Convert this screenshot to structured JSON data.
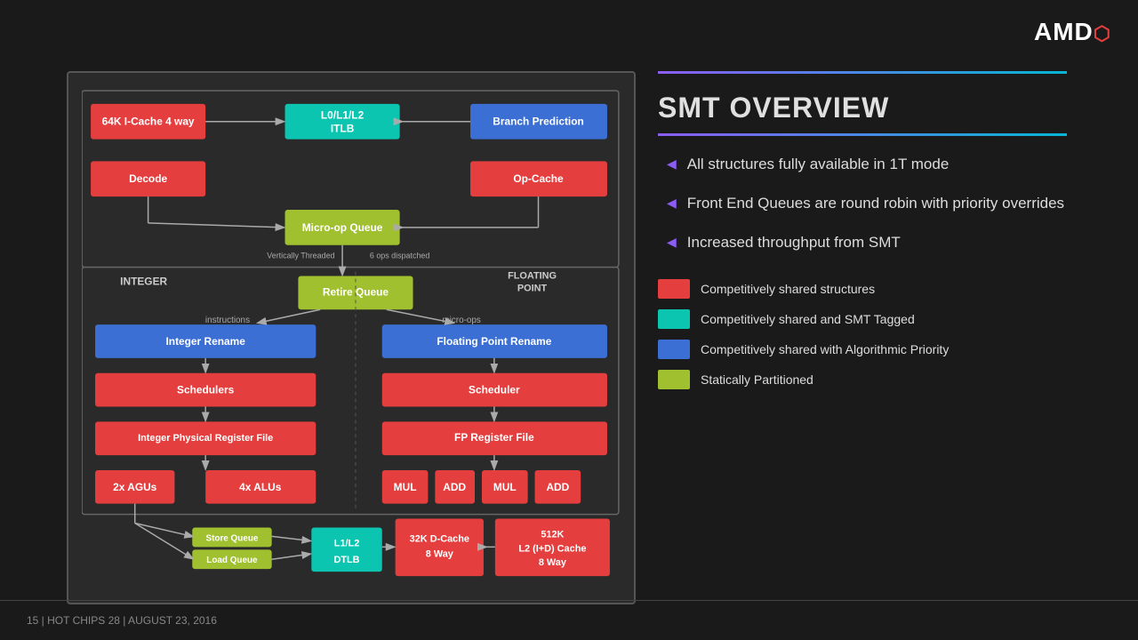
{
  "logo": {
    "text": "AMD",
    "symbol": "⬛"
  },
  "footer": {
    "text": "15  |  HOT CHIPS 28  |  AUGUST 23, 2016"
  },
  "right_panel": {
    "title": "SMT OVERVIEW",
    "bullets": [
      "All structures fully available in 1T mode",
      "Front End Queues are round robin with priority overrides",
      "Increased throughput from SMT"
    ],
    "legend": [
      {
        "color": "red",
        "label": "Competitively shared structures"
      },
      {
        "color": "teal",
        "label": "Competitively shared and SMT Tagged"
      },
      {
        "color": "blue",
        "label": "Competitively shared with Algorithmic Priority"
      },
      {
        "color": "green",
        "label": "Statically Partitioned"
      }
    ]
  },
  "diagram": {
    "top_section_label": "",
    "integer_label": "INTEGER",
    "floating_point_label": "FLOATING POINT",
    "blocks": {
      "icache": "64K I-Cache 4 way",
      "l0l1l2": "L0/L1/L2\nITLB",
      "branch": "Branch Prediction",
      "decode": "Decode",
      "opcache": "Op-Cache",
      "microop_queue": "Micro-op Queue",
      "instructions_label": "instructions",
      "microops_label": "micro-ops",
      "vertically_threaded": "Vertically Threaded",
      "ops_dispatched": "6 ops dispatched",
      "retire_queue": "Retire Queue",
      "integer_rename": "Integer Rename",
      "fp_rename": "Floating Point Rename",
      "schedulers": "Schedulers",
      "fp_scheduler": "Scheduler",
      "int_reg_file": "Integer Physical Register File",
      "fp_reg_file": "FP Register File",
      "agu_2x": "2x AGUs",
      "alu_4x": "4x ALUs",
      "mul1": "MUL",
      "add1": "ADD",
      "mul2": "MUL",
      "add2": "ADD",
      "store_queue": "Store Queue",
      "load_queue": "Load Queue",
      "l1l2_dtlb": "L1/L2\nDTLB",
      "dcache": "32K D-Cache\n8 Way",
      "l2_cache": "512K\nL2 (I+D) Cache\n8 Way"
    }
  }
}
